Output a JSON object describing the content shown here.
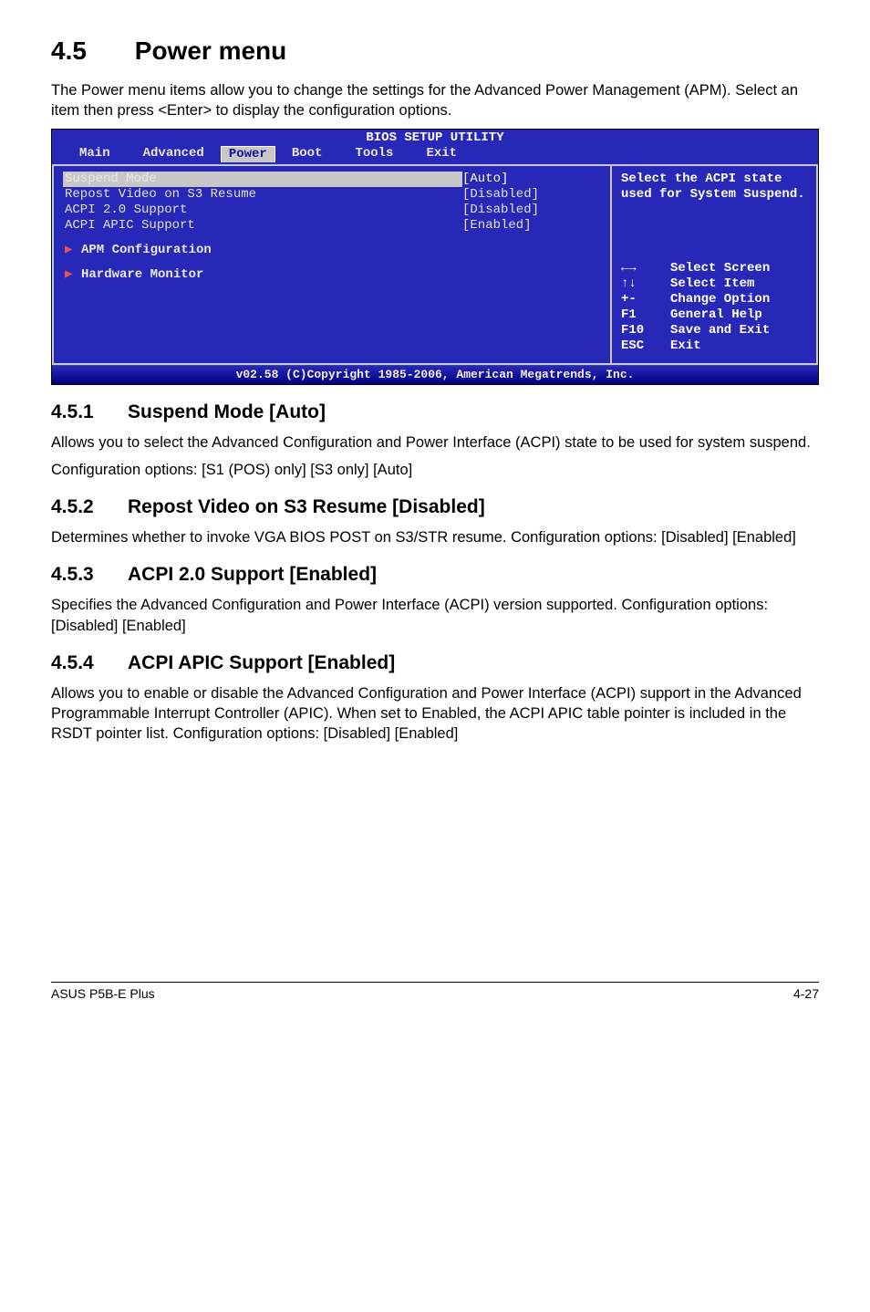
{
  "section_heading": "4.5",
  "section_title": "Power menu",
  "intro_para": "The Power menu items allow you to change the settings for the Advanced Power Management (APM). Select an item then press <Enter> to display the configuration options.",
  "bios": {
    "title": "BIOS SETUP UTILITY",
    "tabs": [
      "Main",
      "Advanced",
      "Power",
      "Boot",
      "Tools",
      "Exit"
    ],
    "active_tab_index": 2,
    "items": [
      {
        "label": "Suspend Mode",
        "value": "[Auto]",
        "selected": true
      },
      {
        "label": "Repost Video on S3 Resume",
        "value": "[Disabled]"
      },
      {
        "label": "ACPI 2.0 Support",
        "value": "[Disabled]"
      },
      {
        "label": "ACPI APIC Support",
        "value": "[Enabled]"
      }
    ],
    "sub": [
      "APM Configuration",
      "Hardware Monitor"
    ],
    "help_text": "Select the ACPI state used for System Suspend.",
    "nav": [
      {
        "key": "←→",
        "desc": "Select Screen",
        "cls": "arrows-lr"
      },
      {
        "key": "↑↓",
        "desc": "Select Item",
        "cls": "arrows-ud"
      },
      {
        "key": "+-",
        "desc": "Change Option"
      },
      {
        "key": "F1",
        "desc": "General Help"
      },
      {
        "key": "F10",
        "desc": "Save and Exit"
      },
      {
        "key": "ESC",
        "desc": "Exit"
      }
    ],
    "footer": "v02.58 (C)Copyright 1985-2006, American Megatrends, Inc."
  },
  "subsections": [
    {
      "num": "4.5.1",
      "title": "Suspend Mode [Auto]",
      "paras": [
        "Allows you to select the Advanced Configuration and Power Interface (ACPI) state to be used for system suspend.",
        "Configuration options: [S1 (POS) only] [S3 only] [Auto]"
      ]
    },
    {
      "num": "4.5.2",
      "title": "Repost Video on S3 Resume [Disabled]",
      "paras": [
        "Determines whether to invoke VGA BIOS POST on S3/STR resume. Configuration options: [Disabled] [Enabled]"
      ]
    },
    {
      "num": "4.5.3",
      "title": "ACPI 2.0 Support [Enabled]",
      "paras": [
        "Specifies the Advanced Configuration and Power Interface (ACPI) version supported. Configuration options: [Disabled] [Enabled]"
      ]
    },
    {
      "num": "4.5.4",
      "title": "ACPI APIC Support [Enabled]",
      "paras": [
        "Allows you to enable or disable the Advanced Configuration and Power Interface (ACPI) support in the Advanced Programmable Interrupt Controller (APIC). When set to Enabled, the ACPI APIC table pointer is included in the RSDT pointer list. Configuration options: [Disabled] [Enabled]"
      ]
    }
  ],
  "footer_left": "ASUS P5B-E Plus",
  "footer_right": "4-27"
}
